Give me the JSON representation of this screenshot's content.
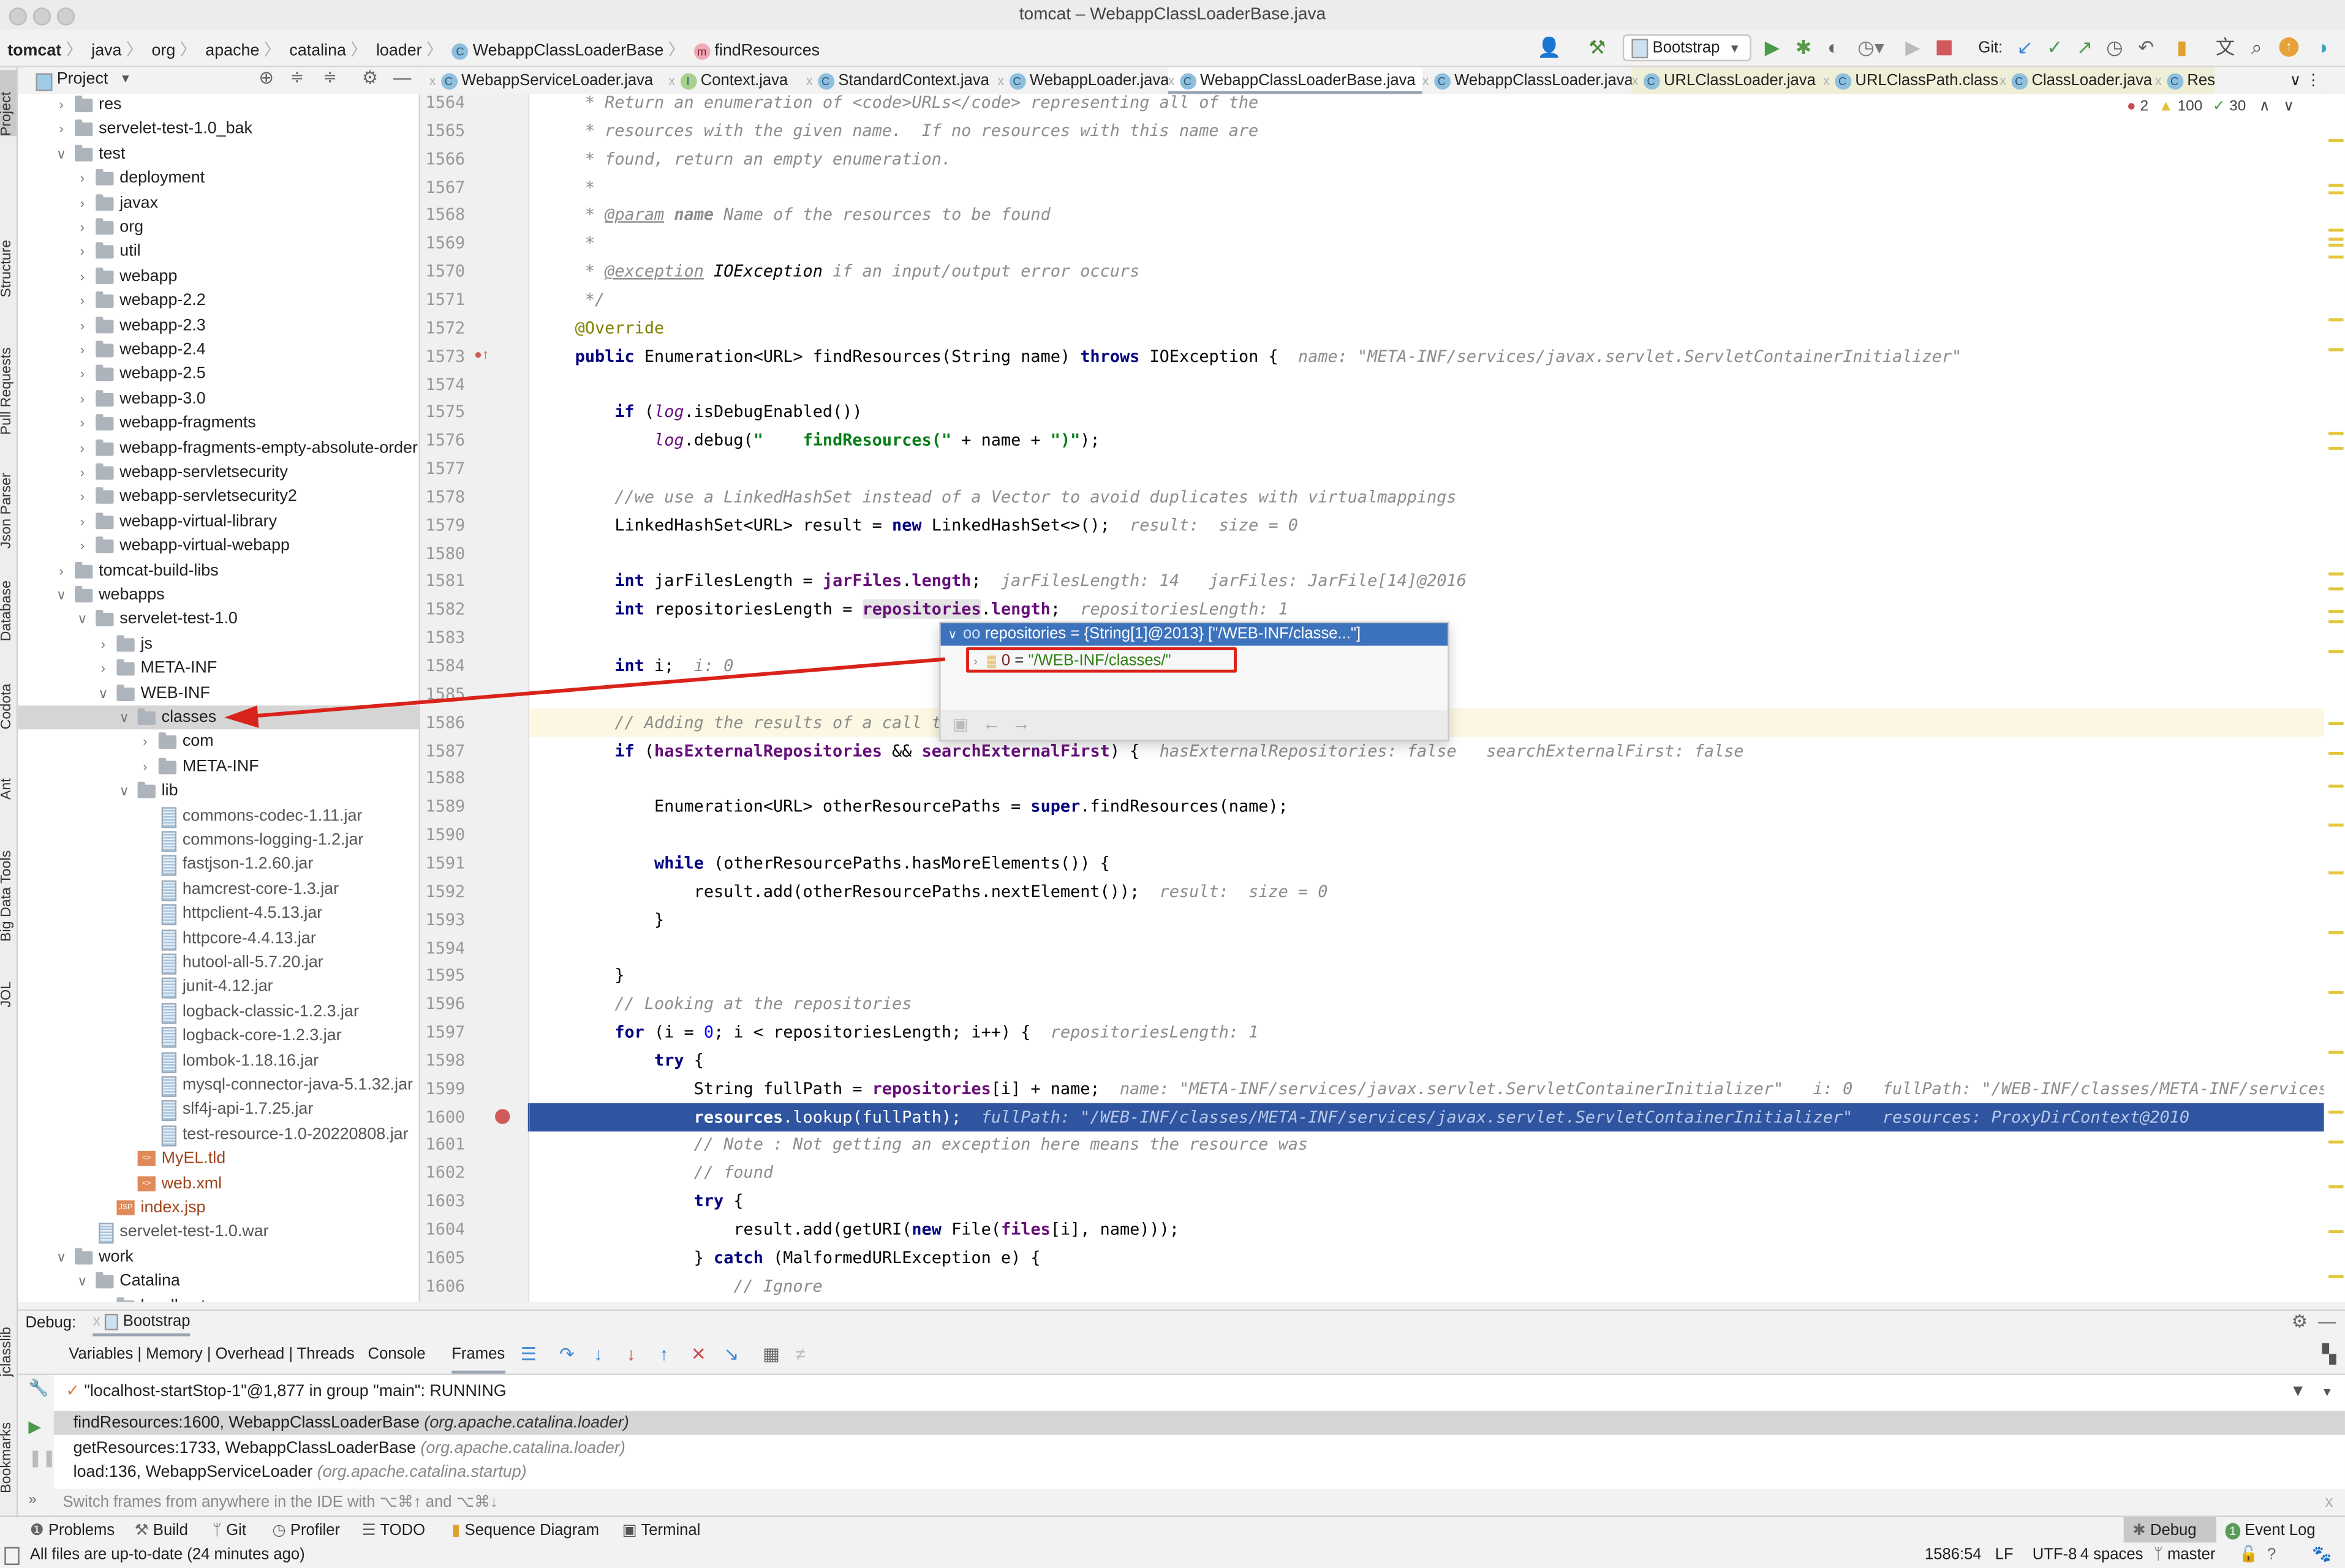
{
  "window": {
    "title": "tomcat – WebappClassLoaderBase.java"
  },
  "breadcrumb": [
    "tomcat",
    "java",
    "org",
    "apache",
    "catalina",
    "loader",
    "WebappClassLoaderBase",
    "findResources"
  ],
  "toolbar": {
    "run_config": "Bootstrap",
    "git_label": "Git:"
  },
  "left_strip": [
    "Project",
    "Structure",
    "Pull Requests",
    "Json Parser",
    "Database",
    "Codota",
    "Ant",
    "Big Data Tools",
    "JOL",
    "jclasslib",
    "Bookmarks"
  ],
  "project_panel": {
    "title": "Project"
  },
  "tree": [
    {
      "label": "res",
      "depth": 1,
      "expanded": false,
      "type": "folder"
    },
    {
      "label": "servelet-test-1.0_bak",
      "depth": 1,
      "expanded": false,
      "type": "folder"
    },
    {
      "label": "test",
      "depth": 1,
      "expanded": true,
      "type": "folder"
    },
    {
      "label": "deployment",
      "depth": 2,
      "expanded": false,
      "type": "folder"
    },
    {
      "label": "javax",
      "depth": 2,
      "expanded": false,
      "type": "folder"
    },
    {
      "label": "org",
      "depth": 2,
      "expanded": false,
      "type": "folder"
    },
    {
      "label": "util",
      "depth": 2,
      "expanded": false,
      "type": "folder"
    },
    {
      "label": "webapp",
      "depth": 2,
      "expanded": false,
      "type": "folder"
    },
    {
      "label": "webapp-2.2",
      "depth": 2,
      "expanded": false,
      "type": "folder"
    },
    {
      "label": "webapp-2.3",
      "depth": 2,
      "expanded": false,
      "type": "folder"
    },
    {
      "label": "webapp-2.4",
      "depth": 2,
      "expanded": false,
      "type": "folder"
    },
    {
      "label": "webapp-2.5",
      "depth": 2,
      "expanded": false,
      "type": "folder"
    },
    {
      "label": "webapp-3.0",
      "depth": 2,
      "expanded": false,
      "type": "folder"
    },
    {
      "label": "webapp-fragments",
      "depth": 2,
      "expanded": false,
      "type": "folder"
    },
    {
      "label": "webapp-fragments-empty-absolute-ordering",
      "depth": 2,
      "expanded": false,
      "type": "folder"
    },
    {
      "label": "webapp-servletsecurity",
      "depth": 2,
      "expanded": false,
      "type": "folder"
    },
    {
      "label": "webapp-servletsecurity2",
      "depth": 2,
      "expanded": false,
      "type": "folder"
    },
    {
      "label": "webapp-virtual-library",
      "depth": 2,
      "expanded": false,
      "type": "folder"
    },
    {
      "label": "webapp-virtual-webapp",
      "depth": 2,
      "expanded": false,
      "type": "folder"
    },
    {
      "label": "tomcat-build-libs",
      "depth": 1,
      "expanded": false,
      "type": "folder"
    },
    {
      "label": "webapps",
      "depth": 1,
      "expanded": true,
      "type": "folder"
    },
    {
      "label": "servelet-test-1.0",
      "depth": 2,
      "expanded": true,
      "type": "folder"
    },
    {
      "label": "js",
      "depth": 3,
      "expanded": false,
      "type": "folder"
    },
    {
      "label": "META-INF",
      "depth": 3,
      "expanded": false,
      "type": "folder"
    },
    {
      "label": "WEB-INF",
      "depth": 3,
      "expanded": true,
      "type": "folder"
    },
    {
      "label": "classes",
      "depth": 4,
      "expanded": true,
      "type": "folder",
      "selected": true
    },
    {
      "label": "com",
      "depth": 5,
      "expanded": false,
      "type": "folder"
    },
    {
      "label": "META-INF",
      "depth": 5,
      "expanded": false,
      "type": "folder"
    },
    {
      "label": "lib",
      "depth": 4,
      "expanded": true,
      "type": "folder"
    },
    {
      "label": "commons-codec-1.11.jar",
      "depth": 5,
      "type": "jar"
    },
    {
      "label": "commons-logging-1.2.jar",
      "depth": 5,
      "type": "jar"
    },
    {
      "label": "fastjson-1.2.60.jar",
      "depth": 5,
      "type": "jar"
    },
    {
      "label": "hamcrest-core-1.3.jar",
      "depth": 5,
      "type": "jar"
    },
    {
      "label": "httpclient-4.5.13.jar",
      "depth": 5,
      "type": "jar"
    },
    {
      "label": "httpcore-4.4.13.jar",
      "depth": 5,
      "type": "jar"
    },
    {
      "label": "hutool-all-5.7.20.jar",
      "depth": 5,
      "type": "jar"
    },
    {
      "label": "junit-4.12.jar",
      "depth": 5,
      "type": "jar"
    },
    {
      "label": "logback-classic-1.2.3.jar",
      "depth": 5,
      "type": "jar"
    },
    {
      "label": "logback-core-1.2.3.jar",
      "depth": 5,
      "type": "jar"
    },
    {
      "label": "lombok-1.18.16.jar",
      "depth": 5,
      "type": "jar"
    },
    {
      "label": "mysql-connector-java-5.1.32.jar",
      "depth": 5,
      "type": "jar"
    },
    {
      "label": "slf4j-api-1.7.25.jar",
      "depth": 5,
      "type": "jar"
    },
    {
      "label": "test-resource-1.0-20220808.jar",
      "depth": 5,
      "type": "jar"
    },
    {
      "label": "MyEL.tld",
      "depth": 4,
      "type": "xml"
    },
    {
      "label": "web.xml",
      "depth": 4,
      "type": "xml"
    },
    {
      "label": "index.jsp",
      "depth": 3,
      "type": "jsp"
    },
    {
      "label": "servelet-test-1.0.war",
      "depth": 2,
      "type": "jar"
    },
    {
      "label": "work",
      "depth": 1,
      "expanded": true,
      "type": "folder"
    },
    {
      "label": "Catalina",
      "depth": 2,
      "expanded": true,
      "type": "folder"
    },
    {
      "label": "localhost",
      "depth": 3,
      "expanded": true,
      "type": "folder"
    }
  ],
  "tabs": [
    {
      "label": "WebappServiceLoader.java",
      "icon": "C"
    },
    {
      "label": "Context.java",
      "icon": "I"
    },
    {
      "label": "StandardContext.java",
      "icon": "C"
    },
    {
      "label": "WebappLoader.java",
      "icon": "C"
    },
    {
      "label": "WebappClassLoaderBase.java",
      "icon": "C",
      "active": true
    },
    {
      "label": "WebappClassLoader.java",
      "icon": "C"
    },
    {
      "label": "URLClassLoader.java",
      "icon": "C",
      "readonly": true
    },
    {
      "label": "URLClassPath.class",
      "icon": "C",
      "readonly": true
    },
    {
      "label": "ClassLoader.java",
      "icon": "C",
      "readonly": true
    },
    {
      "label": "Res",
      "icon": "C",
      "readonly": true
    }
  ],
  "inspections": {
    "errors": "2",
    "warnings": "100",
    "weak": "30"
  },
  "code_lines": [
    {
      "n": "1564",
      "html": "<span class='cmt'>     * Return an enumeration of &lt;code&gt;URLs&lt;/code&gt; representing all of the</span>"
    },
    {
      "n": "1565",
      "html": "<span class='cmt'>     * resources with the given name.  If no resources with this name are</span>"
    },
    {
      "n": "1566",
      "html": "<span class='cmt'>     * found, return an empty enumeration.</span>"
    },
    {
      "n": "1567",
      "html": "<span class='cmt'>     *</span>"
    },
    {
      "n": "1568",
      "html": "<span class='cmt'>     * <u>@param</u> <b>name</b> Name of the resources to be found</span>"
    },
    {
      "n": "1569",
      "html": "<span class='cmt'>     *</span>"
    },
    {
      "n": "1570",
      "html": "<span class='cmt'>     * <u>@exception</u> <span style='color:#000'>IOException</span> if an input/output error occurs</span>"
    },
    {
      "n": "1571",
      "html": "<span class='cmt'>     */</span>"
    },
    {
      "n": "1572",
      "html": "    <span class='ann'>@Override</span>"
    },
    {
      "n": "1573",
      "html": "    <span class='kw'>public</span> Enumeration&lt;URL&gt; findResources(String name) <span class='kw'>throws</span> IOException {  <span class='hint'>name: \"META-INF/services/javax.servlet.ServletContainerInitializer\"</span>"
    },
    {
      "n": "1574",
      "html": ""
    },
    {
      "n": "1575",
      "html": "        <span class='kw'>if</span> (<span class='fld' style='font-style:italic;font-weight:normal'>log</span>.isDebugEnabled())"
    },
    {
      "n": "1576",
      "html": "            <span class='fld' style='font-style:italic;font-weight:normal'>log</span>.debug(<span class='str'>\"    findResources(\"</span> + name + <span class='str'>\")\"</span>);"
    },
    {
      "n": "1577",
      "html": ""
    },
    {
      "n": "1578",
      "html": "        <span class='cmt'>//we use a LinkedHashSet instead of a Vector to avoid duplicates with virtualmappings</span>"
    },
    {
      "n": "1579",
      "html": "        LinkedHashSet&lt;URL&gt; result = <span class='kw'>new</span> LinkedHashSet&lt;&gt;();  <span class='hint'>result:  size = 0</span>"
    },
    {
      "n": "1580",
      "html": ""
    },
    {
      "n": "1581",
      "html": "        <span class='kw'>int</span> jarFilesLength = <span class='fld'>jarFiles</span>.<span class='fld'>length</span>;  <span class='hint'>jarFilesLength: 14   jarFiles: JarFile[14]@2016</span>"
    },
    {
      "n": "1582",
      "html": "        <span class='kw'>int</span> repositoriesLength = <span class='fld' style='background:#e4e4e4'>repositories</span>.<span class='fld'>length</span>;  <span class='hint'>repositoriesLength: 1</span>"
    },
    {
      "n": "1583",
      "html": ""
    },
    {
      "n": "1584",
      "html": "        <span class='kw'>int</span> i;  <span class='hint'>i: 0</span>"
    },
    {
      "n": "1585",
      "html": ""
    },
    {
      "n": "1586",
      "html": "        <span class='cmt'>// Adding the results of a call to the superclass</span>"
    },
    {
      "n": "1587",
      "html": "        <span class='kw'>if</span> (<span class='fld'>hasExternalRepositories</span> &amp;&amp; <span class='fld'>searchExternalFirst</span>) {  <span class='hint'>hasExternalRepositories: false   searchExternalFirst: false</span>"
    },
    {
      "n": "1588",
      "html": ""
    },
    {
      "n": "1589",
      "html": "            Enumeration&lt;URL&gt; otherResourcePaths = <span class='kw'>super</span>.findResources(name);"
    },
    {
      "n": "1590",
      "html": ""
    },
    {
      "n": "1591",
      "html": "            <span class='kw'>while</span> (otherResourcePaths.hasMoreElements()) {"
    },
    {
      "n": "1592",
      "html": "                result.add(otherResourcePaths.nextElement());  <span class='hint'>result:  size = 0</span>"
    },
    {
      "n": "1593",
      "html": "            }"
    },
    {
      "n": "1594",
      "html": ""
    },
    {
      "n": "1595",
      "html": "        }"
    },
    {
      "n": "1596",
      "html": "        <span class='cmt'>// Looking at the repositories</span>"
    },
    {
      "n": "1597",
      "html": "        <span class='kw'>for</span> (i = <span style='color:#0000ff'>0</span>; i &lt; repositoriesLength; i++) {  <span class='hint'>repositoriesLength: 1</span>"
    },
    {
      "n": "1598",
      "html": "            <span class='kw'>try</span> {"
    },
    {
      "n": "1599",
      "html": "                String fullPath = <span class='fld'>repositories</span>[i] + name;  <span class='hint'>name: \"META-INF/services/javax.servlet.ServletContainerInitializer\"   i: 0   fullPath: \"/WEB-INF/classes/META-INF/services/javax.servlet.ServletContainerInitializer\"</span>"
    },
    {
      "n": "1600",
      "html": "                <b>resources</b>.lookup(fullPath);  <span style='font-style:italic;color:#b8c8ea'>fullPath: \"/WEB-INF/classes/META-INF/services/javax.servlet.ServletContainerInitializer\"   resources: ProxyDirContext@2010</span>"
    },
    {
      "n": "1601",
      "html": "                <span class='cmt'>// Note : Not getting an exception here means the resource was</span>"
    },
    {
      "n": "1602",
      "html": "                <span class='cmt'>// found</span>"
    },
    {
      "n": "1603",
      "html": "                <span class='kw'>try</span> {"
    },
    {
      "n": "1604",
      "html": "                    result.add(getURI(<span class='kw'>new</span> File(<span class='fld'>files</span>[i], name)));"
    },
    {
      "n": "1605",
      "html": "                } <span class='kw'>catch</span> (MalformedURLException e) {"
    },
    {
      "n": "1606",
      "html": "                    <span class='cmt'>// Ignore</span>"
    }
  ],
  "popup": {
    "header": "repositories = {String[1]@2013} [\"/WEB-INF/classe...\"]",
    "item_index": "0",
    "item_value": "\"/WEB-INF/classes/\""
  },
  "debug": {
    "label": "Debug:",
    "session": "Bootstrap",
    "tabs": [
      "Variables | Memory | Overhead | Threads",
      "Console",
      "Frames"
    ],
    "thread": "\"localhost-startStop-1\"@1,877 in group \"main\": RUNNING",
    "frames": [
      {
        "method": "findResources:1600, WebappClassLoaderBase",
        "pkg": "(org.apache.catalina.loader)",
        "selected": true
      },
      {
        "method": "getResources:1733, WebappClassLoaderBase",
        "pkg": "(org.apache.catalina.loader)"
      },
      {
        "method": "load:136, WebappServiceLoader",
        "pkg": "(org.apache.catalina.startup)"
      }
    ],
    "hint": "Switch frames from anywhere in the IDE with ⌥⌘↑ and ⌥⌘↓"
  },
  "bottom_tools": [
    "Problems",
    "Build",
    "Git",
    "Profiler",
    "TODO",
    "Sequence Diagram",
    "Terminal"
  ],
  "bottom_right": {
    "debug": "Debug",
    "event_log": "Event Log",
    "event_count": "1"
  },
  "status": {
    "message": "All files are up-to-date (24 minutes ago)",
    "position": "1586:54",
    "line_sep": "LF",
    "encoding": "UTF-8",
    "indent": "4 spaces",
    "branch": "master"
  }
}
